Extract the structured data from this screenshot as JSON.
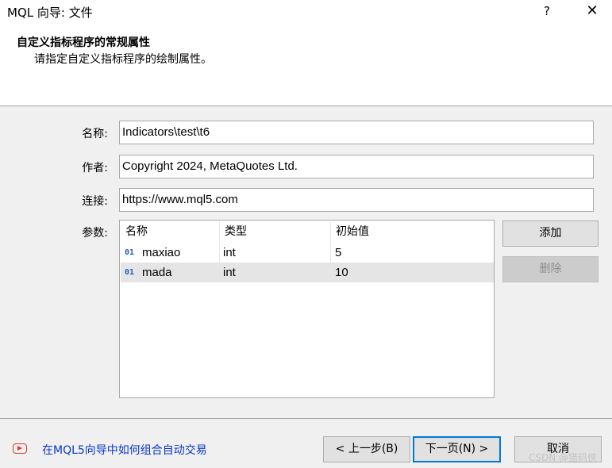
{
  "window": {
    "title": "MQL 向导: 文件",
    "help_label": "?",
    "close_label": "✕"
  },
  "header": {
    "title": "自定义指标程序的常规属性",
    "subtitle": "请指定自定义指标程序的绘制属性。"
  },
  "form": {
    "name_label": "名称:",
    "name_value": "Indicators\\test\\t6",
    "author_label": "作者:",
    "author_value": "Copyright 2024, MetaQuotes Ltd.",
    "link_label": "连接:",
    "link_value": "https://www.mql5.com",
    "params_label": "参数:"
  },
  "params_table": {
    "columns": [
      "名称",
      "类型",
      "初始值"
    ],
    "rows": [
      {
        "icon": "01",
        "name": "maxiao",
        "type": "int",
        "value": "5",
        "selected": false
      },
      {
        "icon": "01",
        "name": "mada",
        "type": "int",
        "value": "10",
        "selected": true
      }
    ]
  },
  "side_buttons": {
    "add_label": "添加",
    "delete_label": "删除"
  },
  "footer": {
    "link_text": "在MQL5向导中如何组合自动交易",
    "back_label": "< 上一步(B)",
    "next_label": "下一页(N) >",
    "cancel_label": "取消",
    "watermark": "CSDN @猎码侠"
  },
  "colors": {
    "accent": "#0078d7",
    "link": "#0a37c8",
    "video_icon": "#e0382f",
    "selected_row": "#e5e5e5"
  },
  "icons": {
    "video": "video-play-icon",
    "variable": "variable-icon"
  }
}
